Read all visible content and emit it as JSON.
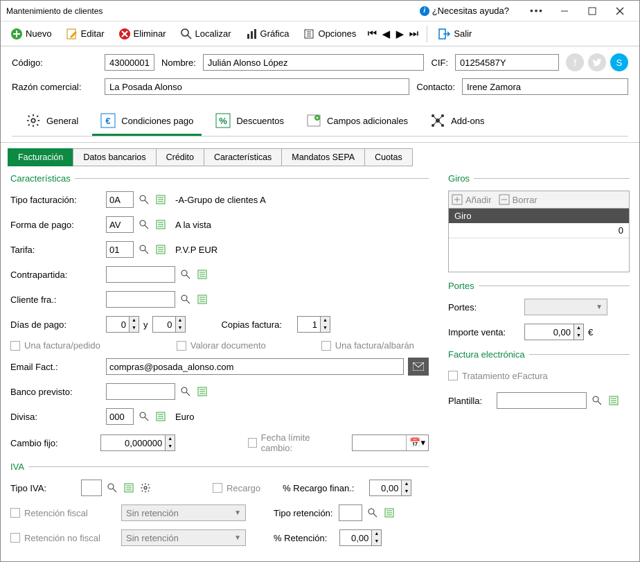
{
  "window": {
    "title": "Mantenimiento de clientes",
    "help": "¿Necesitas ayuda?"
  },
  "toolbar": {
    "nuevo": "Nuevo",
    "editar": "Editar",
    "eliminar": "Eliminar",
    "localizar": "Localizar",
    "grafica": "Gráfica",
    "opciones": "Opciones",
    "salir": "Salir"
  },
  "header": {
    "codigo_lbl": "Código:",
    "codigo": "43000001",
    "nombre_lbl": "Nombre:",
    "nombre": "Julián Alonso López",
    "cif_lbl": "CIF:",
    "cif": "01254587Y",
    "razon_lbl": "Razón comercial:",
    "razon": "La Posada Alonso",
    "contacto_lbl": "Contacto:",
    "contacto": "Irene Zamora"
  },
  "maintabs": {
    "general": "General",
    "cond": "Condiciones pago",
    "desc": "Descuentos",
    "campos": "Campos adicionales",
    "addons": "Add-ons"
  },
  "subtabs": {
    "fact": "Facturación",
    "banc": "Datos bancarios",
    "credito": "Crédito",
    "carac": "Características",
    "sepa": "Mandatos SEPA",
    "cuotas": "Cuotas"
  },
  "caract": {
    "title": "Características",
    "tipo_fact_lbl": "Tipo facturación:",
    "tipo_fact": "0A",
    "tipo_fact_desc": "-A-Grupo de clientes A",
    "forma_lbl": "Forma de pago:",
    "forma": "AV",
    "forma_desc": "A la vista",
    "tarifa_lbl": "Tarifa:",
    "tarifa": "01",
    "tarifa_desc": "P.V.P EUR",
    "contra_lbl": "Contrapartida:",
    "contra": "",
    "cliente_fra_lbl": "Cliente fra.:",
    "cliente_fra": "",
    "dias_lbl": "Días de pago:",
    "dias1": "0",
    "y": "y",
    "dias2": "0",
    "copias_lbl": "Copias factura:",
    "copias": "1",
    "chk1": "Una factura/pedido",
    "chk2": "Valorar documento",
    "chk3": "Una factura/albarán",
    "email_lbl": "Email Fact.:",
    "email": "compras@posada_alonso.com",
    "banco_lbl": "Banco previsto:",
    "banco": "",
    "divisa_lbl": "Divisa:",
    "divisa": "000",
    "divisa_desc": "Euro",
    "cambio_lbl": "Cambio fijo:",
    "cambio": "0,000000",
    "fecha_limite_lbl": "Fecha límite cambio:"
  },
  "iva": {
    "title": "IVA",
    "tipo_lbl": "Tipo IVA:",
    "tipo": "",
    "recargo_chk": "Recargo",
    "recfin_lbl": "% Recargo finan.:",
    "recfin": "0,00",
    "retfiscal_chk": "Retención fiscal",
    "sinret": "Sin retención",
    "tiporet_lbl": "Tipo retención:",
    "retnofiscal_chk": "Retención no fiscal",
    "pctret_lbl": "% Retención:",
    "pctret": "0,00"
  },
  "giros": {
    "title": "Giros",
    "anadir": "Añadir",
    "borrar": "Borrar",
    "head": "Giro",
    "row0": "0"
  },
  "portes": {
    "title": "Portes",
    "portes_lbl": "Portes:",
    "importe_lbl": "Importe venta:",
    "importe": "0,00",
    "cur": "€"
  },
  "efact": {
    "title": "Factura electrónica",
    "trat": "Tratamiento eFactura",
    "plantilla_lbl": "Plantilla:"
  }
}
